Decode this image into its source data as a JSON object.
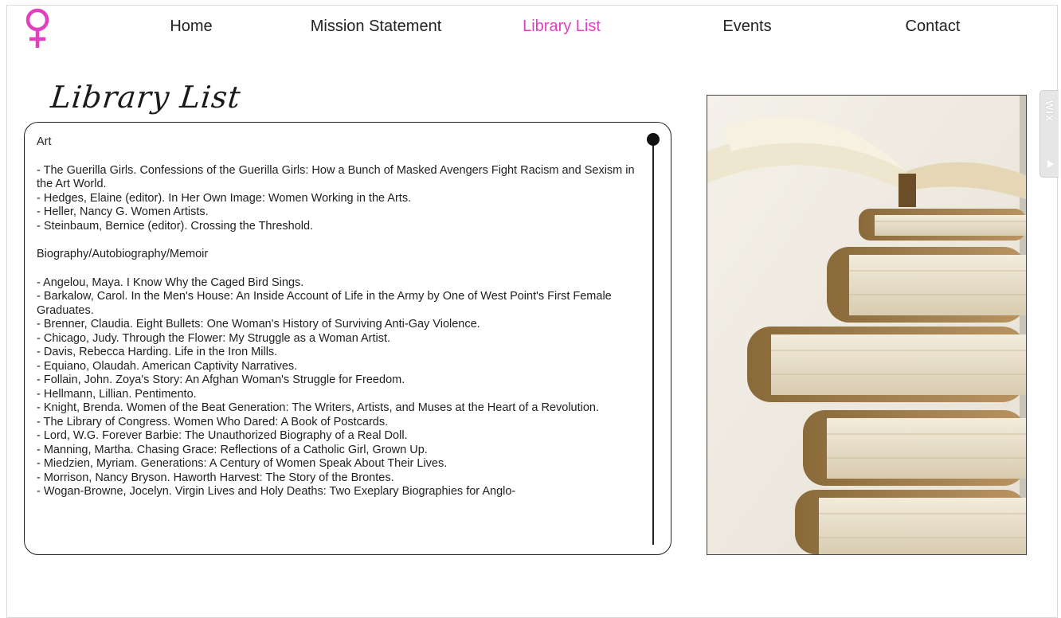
{
  "nav": {
    "items": [
      {
        "label": "Home",
        "active": false
      },
      {
        "label": "Mission Statement",
        "active": false
      },
      {
        "label": "Library List",
        "active": true
      },
      {
        "label": "Events",
        "active": false
      },
      {
        "label": "Contact",
        "active": false
      }
    ]
  },
  "logo": {
    "icon": "venus-symbol-icon",
    "color": "#e040c0"
  },
  "page_title": "Library List",
  "library": {
    "sections": [
      {
        "heading": "Art",
        "entries": [
          "- The Guerilla Girls. Confessions of the Guerilla Girls: How a Bunch of Masked Avengers Fight Racism and Sexism in the Art World.",
          "- Hedges, Elaine (editor). In Her Own Image: Women Working in the Arts.",
          "- Heller, Nancy G. Women Artists.",
          "- Steinbaum, Bernice (editor). Crossing the Threshold."
        ]
      },
      {
        "heading": "Biography/Autobiography/Memoir",
        "entries": [
          "- Angelou, Maya. I Know Why the Caged Bird Sings.",
          "- Barkalow, Carol. In the Men's House: An Inside Account of Life in the Army by One of West Point's First Female Graduates.",
          "- Brenner, Claudia. Eight Bullets: One Woman's History of Surviving Anti-Gay Violence.",
          "- Chicago, Judy. Through the Flower: My Struggle as a Woman Artist.",
          "- Davis, Rebecca Harding. Life in the Iron Mills.",
          "- Equiano, Olaudah. American Captivity Narratives.",
          "- Follain, John. Zoya's Story: An Afghan Woman's Struggle for Freedom.",
          "- Hellmann, Lillian. Pentimento.",
          "- Knight, Brenda. Women of the Beat Generation: The Writers, Artists, and Muses at the Heart of a Revolution.",
          "- The Library of Congress. Women Who Dared: A Book of Postcards.",
          "- Lord, W.G. Forever Barbie: The Unauthorized Biography of a Real Doll.",
          "- Manning, Martha. Chasing Grace: Reflections of a Catholic Girl, Grown Up.",
          "- Miedzien, Myriam. Generations: A Century of Women Speak About Their Lives.",
          "- Morrison, Nancy Bryson. Haworth Harvest: The Story of the Brontes.",
          "- Wogan-Browne, Jocelyn. Virgin Lives and Holy Deaths: Two Exeplary Biographies for Anglo-"
        ]
      }
    ]
  },
  "side_image": {
    "icon": "stacked-books-photo"
  },
  "wix_badge": {
    "text": "WIX",
    "icon": "play-icon"
  },
  "colors": {
    "accent": "#e040c0",
    "text": "#222222",
    "border": "#222222"
  }
}
